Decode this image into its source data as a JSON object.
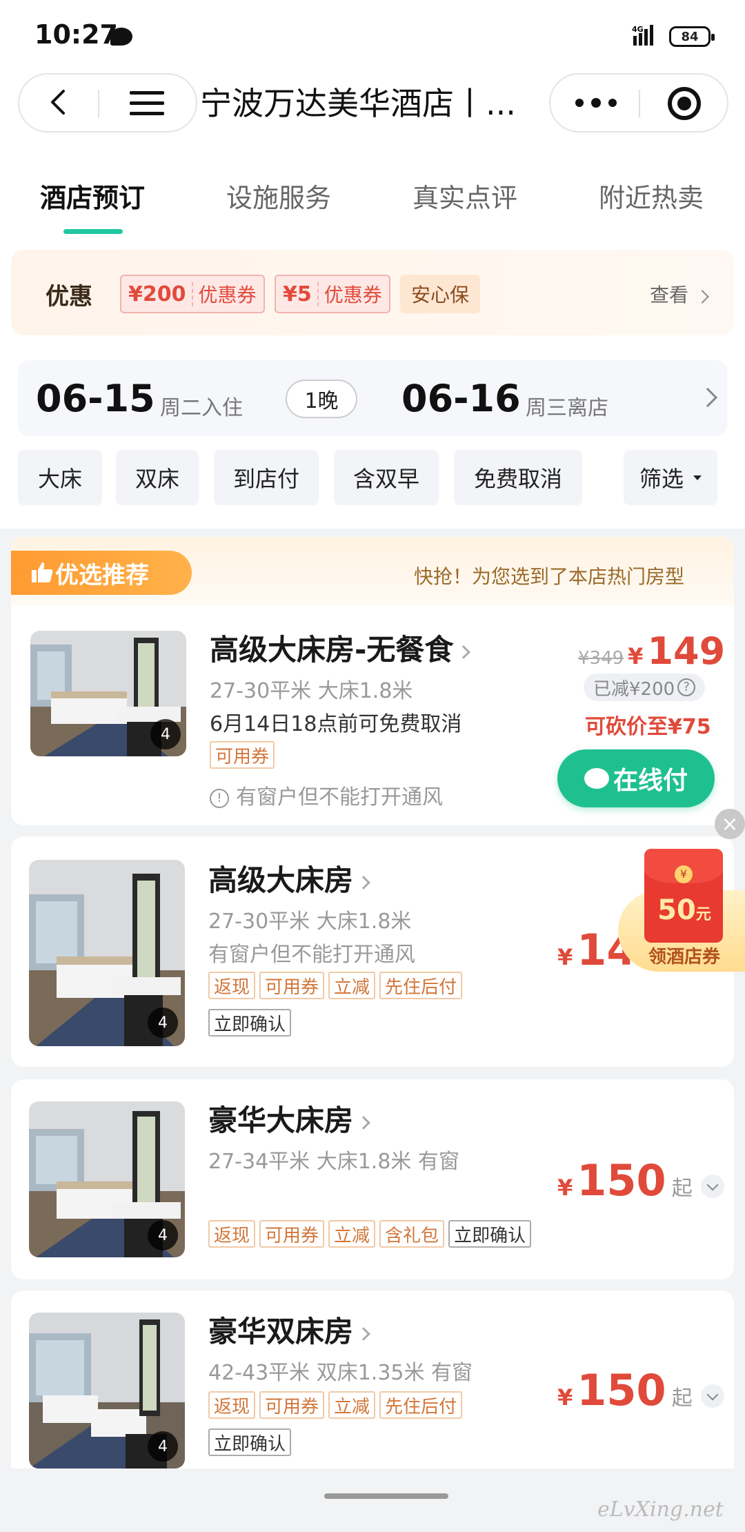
{
  "status": {
    "time": "10:27",
    "network": "4G",
    "battery": "84"
  },
  "nav": {
    "title": "宁波万达美华酒店丨..."
  },
  "tabs": [
    {
      "label": "酒店预订",
      "active": true
    },
    {
      "label": "设施服务"
    },
    {
      "label": "真实点评"
    },
    {
      "label": "附近热卖"
    }
  ],
  "promo": {
    "label": "优惠",
    "coupons": [
      {
        "amount": "¥200",
        "label": "优惠券"
      },
      {
        "amount": "¥5",
        "label": "优惠券"
      }
    ],
    "anxin": "安心保",
    "view": "查看"
  },
  "dates": {
    "checkin": "06-15",
    "checkin_label": "周二入住",
    "nights": "1晚",
    "checkout": "06-16",
    "checkout_label": "周三离店"
  },
  "filters": [
    "大床",
    "双床",
    "到店付",
    "含双早",
    "免费取消",
    "筛选"
  ],
  "recommend": {
    "badge": "优选推荐",
    "tip": "快抢！为您选到了本店热门房型",
    "room": {
      "name": "高级大床房-无餐食",
      "spec": "27-30平米  大床1.8米",
      "cancel": "6月14日18点前可免费取消",
      "tag": "可用券",
      "notice": "有窗户但不能打开通风",
      "img_count": "4",
      "original_price": "¥349",
      "currency": "¥",
      "price": "149",
      "discount": "已减¥200",
      "bargain": "可砍价至¥75",
      "pay_button": "在线付"
    }
  },
  "rooms": [
    {
      "name": "高级大床房",
      "spec": "27-30平米  大床1.8米",
      "extra": "有窗户但不能打开通风",
      "tags": [
        "返现",
        "可用券",
        "立减",
        "先住后付"
      ],
      "gray_tag": "立即确认",
      "img_count": "4",
      "currency": "¥",
      "price": "149"
    },
    {
      "name": "豪华大床房",
      "spec": "27-34平米  大床1.8米  有窗",
      "tags": [
        "返现",
        "可用券",
        "立减",
        "含礼包"
      ],
      "gray_tag": "立即确认",
      "img_count": "4",
      "currency": "¥",
      "price": "150",
      "suffix": "起"
    },
    {
      "name": "豪华双床房",
      "spec": "42-43平米  双床1.35米  有窗",
      "tags": [
        "返现",
        "可用券",
        "立减",
        "先住后付"
      ],
      "gray_tag": "立即确认",
      "img_count": "4",
      "currency": "¥",
      "price": "150",
      "suffix": "起"
    }
  ],
  "red_packet": {
    "coin": "¥",
    "amount": "50",
    "unit": "元",
    "label": "领酒店券"
  },
  "watermark": "eLvXing.net",
  "colors": {
    "accent": "#1fc8a0",
    "price": "#e04a3a",
    "pay": "#1fc08f",
    "tag": "#d2763a"
  }
}
